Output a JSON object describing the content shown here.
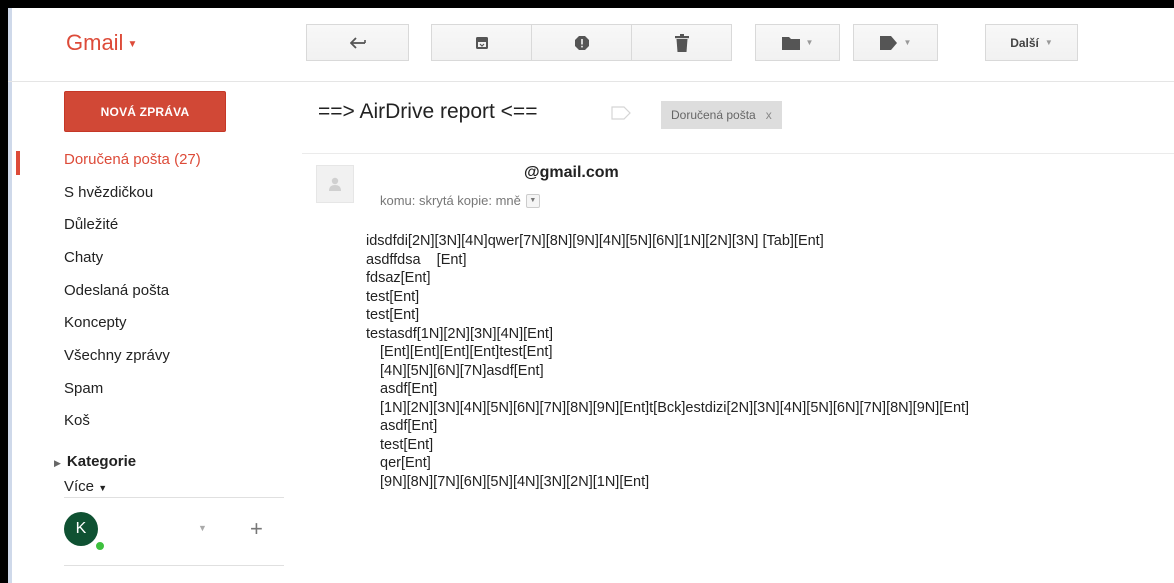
{
  "app": {
    "logo": "Gmail"
  },
  "toolbar": {
    "icons": [
      "back-icon",
      "archive-icon",
      "spam-icon",
      "trash-icon",
      "folder-icon",
      "tag-icon"
    ],
    "more_label": "Další"
  },
  "sidebar": {
    "compose_label": "NOVÁ ZPRÁVA",
    "items": [
      {
        "label": "Doručená pošta (27)",
        "active": true
      },
      {
        "label": "S hvězdičkou"
      },
      {
        "label": "Důležité"
      },
      {
        "label": "Chaty"
      },
      {
        "label": "Odeslaná pošta"
      },
      {
        "label": "Koncepty"
      },
      {
        "label": "Všechny zprávy"
      },
      {
        "label": "Spam"
      },
      {
        "label": "Koš"
      }
    ],
    "categories_label": "Kategorie",
    "more_label": "Více",
    "avatar_initial": "K"
  },
  "message": {
    "subject": "==> AirDrive report <==",
    "label_chip": "Doručená pošta",
    "label_chip_close": "x",
    "sender": "@gmail.com",
    "recipients": "komu: skrytá kopie: mně",
    "body_lines": [
      "idsdfdi[2N][3N][4N]qwer[7N][8N][9N][4N][5N][6N][1N][2N][3N] [Tab][Ent]",
      "asdffdsa    [Ent]",
      "fdsaz[Ent]",
      "test[Ent]",
      "test[Ent]",
      "testasdf[1N][2N][3N][4N][Ent]",
      "[Ent][Ent][Ent][Ent]test[Ent]",
      "[4N][5N][6N][7N]asdf[Ent]",
      "asdf[Ent]",
      "[1N][2N][3N][4N][5N][6N][7N][8N][9N][Ent]t[Bck]estdizi[2N][3N][4N][5N][6N][7N][8N][9N][Ent]",
      "asdf[Ent]",
      "test[Ent]",
      "qer[Ent]",
      "[9N][8N][7N][6N][5N][4N][3N][2N][1N][Ent]"
    ]
  },
  "colors": {
    "accent": "#dd4b39",
    "compose": "#d14836",
    "avatar": "#0f5132",
    "online": "#3ec03e"
  }
}
